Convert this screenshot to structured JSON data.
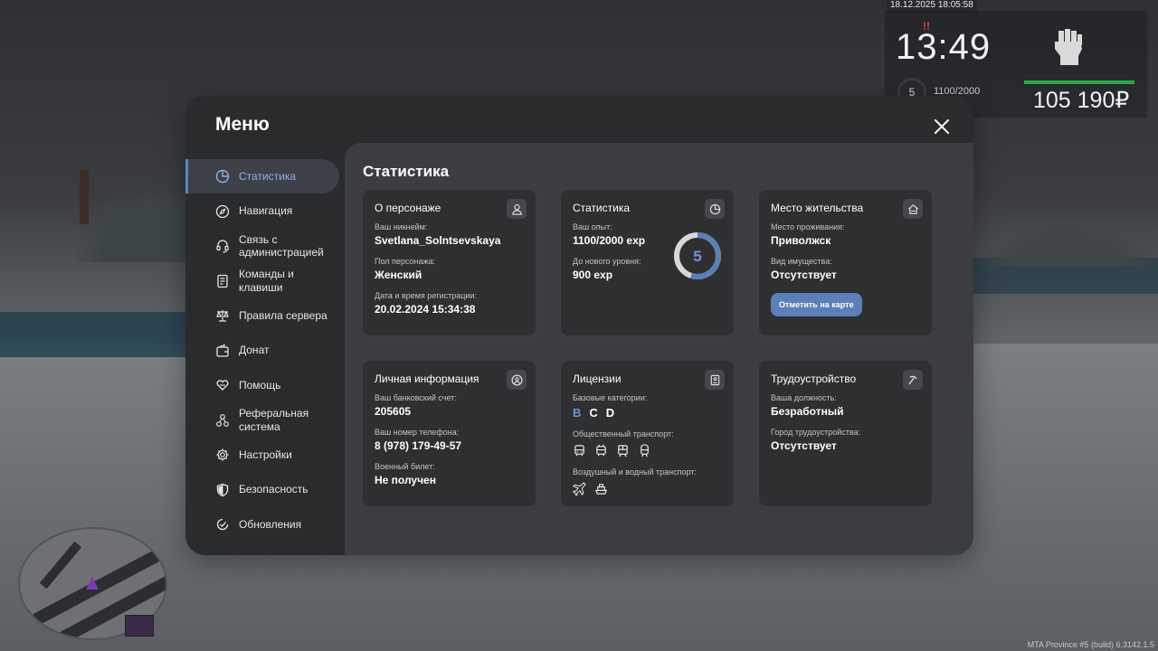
{
  "hud": {
    "date": "18.12.2025 18:05:58",
    "time": "13:49",
    "level": "5",
    "exp": "1100/2000",
    "money": "105 190₽",
    "alarm": "!!"
  },
  "watermark": "MTA Province #5 (build) 6.3142.1.5",
  "panel": {
    "title": "Меню",
    "content_title": "Статистика"
  },
  "sidebar": {
    "items": [
      {
        "label": "Статистика",
        "icon": "pie-chart-icon"
      },
      {
        "label": "Навигация",
        "icon": "compass-icon"
      },
      {
        "label": "Связь с администрацией",
        "icon": "headset-icon"
      },
      {
        "label": "Команды и клавиши",
        "icon": "document-icon"
      },
      {
        "label": "Правила сервера",
        "icon": "scales-icon"
      },
      {
        "label": "Донат",
        "icon": "wallet-icon"
      },
      {
        "label": "Помощь",
        "icon": "heart-hands-icon"
      },
      {
        "label": "Реферальная система",
        "icon": "network-icon"
      },
      {
        "label": "Настройки",
        "icon": "gear-icon"
      },
      {
        "label": "Безопасность",
        "icon": "shield-icon"
      },
      {
        "label": "Обновления",
        "icon": "check-circle-icon"
      }
    ]
  },
  "cards": {
    "character": {
      "title": "О персонаже",
      "nickname_label": "Ваш никнейм:",
      "nickname": "Svetlana_Solntsevskaya",
      "gender_label": "Пол персонажа:",
      "gender": "Женский",
      "reg_label": "Дата и время регистрации:",
      "reg_date": "20.02.2024 15:34:38"
    },
    "stats": {
      "title": "Статистика",
      "exp_label": "Ваш опыт:",
      "exp": "1100/2000 exp",
      "next_label": "До нового уровня:",
      "next": "900 exp",
      "level": "5",
      "progress": 0.55
    },
    "residence": {
      "title": "Место жительства",
      "place_label": "Место проживания:",
      "place": "Приволжск",
      "property_label": "Вид имущества:",
      "property": "Отсутствует",
      "button": "Отметить на карте"
    },
    "personal": {
      "title": "Личная информация",
      "bank_label": "Ваш банковский счет:",
      "bank": "205605",
      "phone_label": "Ваш номер телефона:",
      "phone": "8 (978) 179-49-57",
      "military_label": "Военный билет:",
      "military": "Не получен"
    },
    "licenses": {
      "title": "Лицензии",
      "base_label": "Базовые категории:",
      "categories": [
        {
          "letter": "B",
          "active": true
        },
        {
          "letter": "C",
          "active": false
        },
        {
          "letter": "D",
          "active": false
        }
      ],
      "public_label": "Общественный транспорт:",
      "public_icons": [
        "bus-icon",
        "trolleybus-icon",
        "tram-icon",
        "train-icon"
      ],
      "air_water_label": "Воздушный и водный транспорт:",
      "air_water_icons": [
        "plane-icon",
        "ship-icon"
      ]
    },
    "employment": {
      "title": "Трудоустройство",
      "position_label": "Ваша должность:",
      "position": "Безработный",
      "city_label": "Город трудоустройства:",
      "city": "Отсутствует"
    }
  },
  "colors": {
    "accent": "#5b7fb8",
    "active_nav": "#8fb0e3",
    "panel": "#2a2b2d",
    "content": "#3b3d40",
    "card": "#2e2f31",
    "money_bar": "#2ea84a"
  }
}
